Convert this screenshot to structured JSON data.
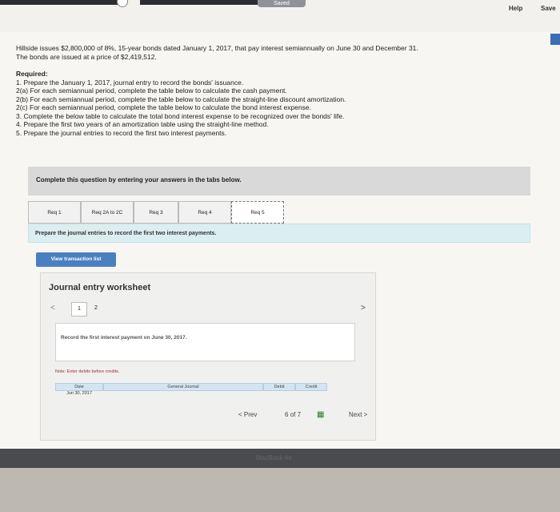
{
  "topbar": {
    "saved_label": "Saved",
    "help_label": "Help",
    "save_label": "Save"
  },
  "intro": {
    "line1": "Hillside issues $2,800,000 of 8%, 15-year bonds dated January 1, 2017, that pay interest semiannually on June 30 and December 31.",
    "line2": "The bonds are issued at a price of $2,419,512."
  },
  "required": {
    "heading": "Required:",
    "items": [
      "1. Prepare the January 1, 2017, journal entry to record the bonds' issuance.",
      "2(a) For each semiannual period, complete the table below to calculate the cash payment.",
      "2(b) For each semiannual period, complete the table below to calculate the straight-line discount amortization.",
      "2(c) For each semiannual period, complete the table below to calculate the bond interest expense.",
      "3. Complete the below table to calculate the total bond interest expense to be recognized over the bonds' life.",
      "4. Prepare the first two years of an amortization table using the straight-line method.",
      "5. Prepare the journal entries to record the first two interest payments."
    ]
  },
  "banner": "Complete this question by entering your answers in the tabs below.",
  "tabs": [
    "Req 1",
    "Req 2A to 2C",
    "Req 3",
    "Req 4",
    "Req 5"
  ],
  "hint": "Prepare the journal entries to record the first two interest payments.",
  "view_transaction_label": "View transaction list",
  "worksheet": {
    "title": "Journal entry worksheet",
    "pages": [
      "1",
      "2"
    ],
    "record_text": "Record the first interest payment on June 30, 2017.",
    "note": "Note: Enter debits before credits.",
    "columns": [
      "Date",
      "General Journal",
      "Debit",
      "Credit"
    ],
    "date_value": "Jun 30, 2017"
  },
  "nav": {
    "prev": "Prev",
    "page_current": "6",
    "page_of": "of",
    "page_total": "7",
    "next": "Next"
  },
  "footer": {
    "brand": "MacBook Air"
  }
}
